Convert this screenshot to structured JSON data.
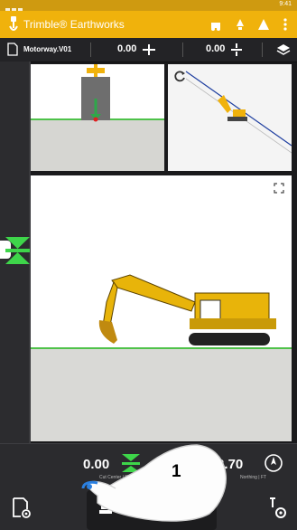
{
  "app": {
    "title": "Trimble® Earthworks"
  },
  "statusbar": {
    "time": "9:41"
  },
  "toolbar": {
    "design_name": "Motorway.V01",
    "cross_slope_value": "0.00",
    "elevation_value": "0.00"
  },
  "bottom": {
    "cut_value": "0.00",
    "cut_label": "Cut Center | FT",
    "northing_value": "2279872.70",
    "northing_label": "Northing | FT"
  },
  "callout": {
    "number": "1"
  },
  "colors": {
    "brand": "#f0b20c",
    "target_green": "#3ed54a",
    "cursor_blue": "#2a7fe0"
  }
}
